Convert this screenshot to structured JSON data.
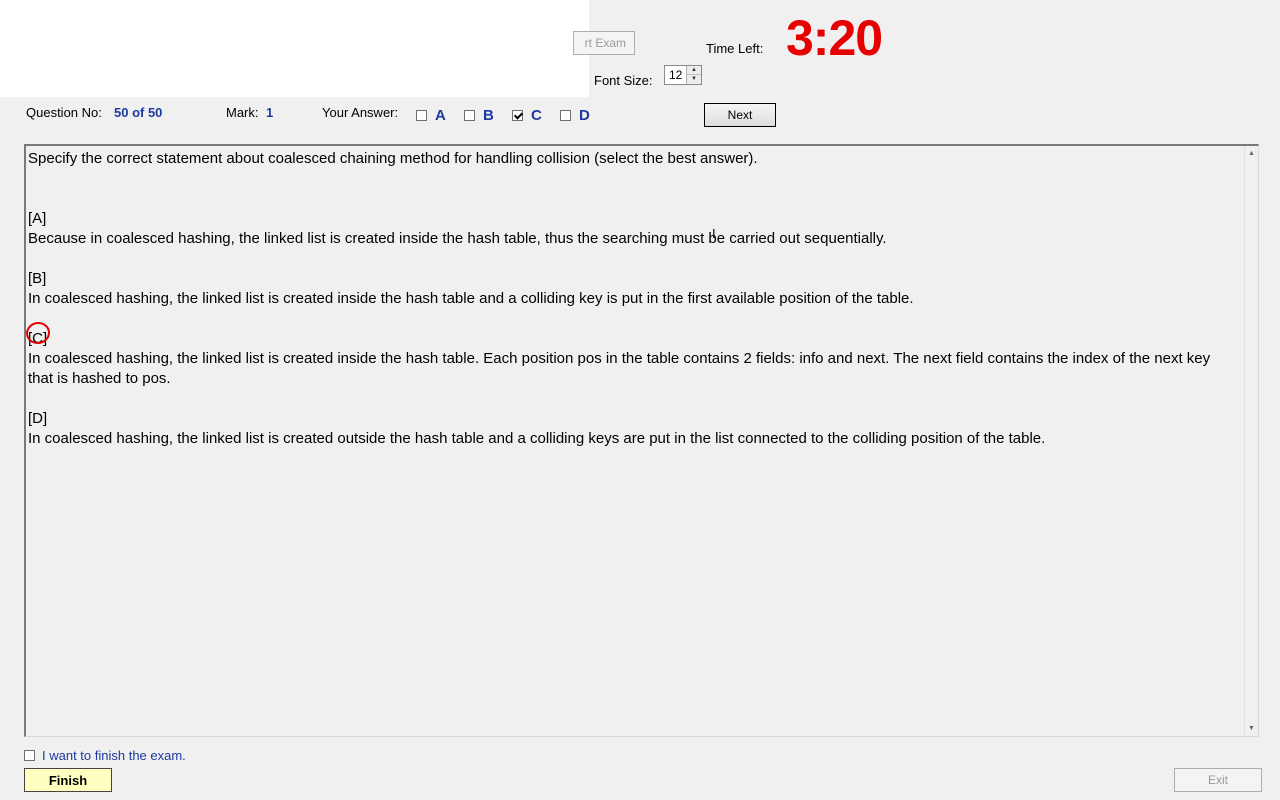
{
  "header": {
    "start_exam_label": "rt Exam",
    "time_left_label": "Time Left:",
    "timer": "3:20",
    "font_size_label": "Font Size:",
    "font_size_value": "12"
  },
  "question_bar": {
    "question_no_label": "Question No:",
    "question_no_value": "50 of 50",
    "mark_label": "Mark:",
    "mark_value": "1",
    "your_answer_label": "Your Answer:",
    "choices": [
      {
        "letter": "A",
        "checked": false
      },
      {
        "letter": "B",
        "checked": false
      },
      {
        "letter": "C",
        "checked": true
      },
      {
        "letter": "D",
        "checked": false
      }
    ],
    "next_label": "Next"
  },
  "question": {
    "prompt": "Specify the correct statement about coalesced chaining method for handling collision (select the best answer).",
    "options": [
      {
        "tag": "[A]",
        "text": "Because in coalesced hashing, the linked list is created inside the hash table, thus the searching must be carried out sequentially."
      },
      {
        "tag": "[B]",
        "text": "In coalesced hashing, the linked list is created inside the hash table and a colliding key is put in the first  available position of the table."
      },
      {
        "tag": "[C]",
        "text": "In coalesced hashing, the linked list is created inside the hash table. Each position pos in the table contains 2 fields: info and next. The next field contains the index of the next key that is hashed to pos."
      },
      {
        "tag": "[D]",
        "text": "In coalesced hashing, the linked list is created outside the hash table and a colliding keys are put in the list  connected to the colliding position of the table."
      }
    ]
  },
  "footer": {
    "finish_check_label": "I want to finish the exam.",
    "finish_label": "Finish",
    "exit_label": "Exit"
  },
  "colors": {
    "timer": "#e60000",
    "accent_blue": "#1c3aa0",
    "finish_button_bg": "#ffffc0"
  }
}
